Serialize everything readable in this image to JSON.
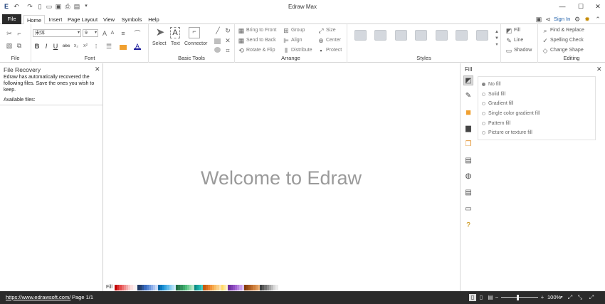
{
  "window": {
    "title": "Edraw Max",
    "minimize": "—",
    "maximize": "☐",
    "close": "✕"
  },
  "tabs": [
    "File",
    "Home",
    "Insert",
    "Page Layout",
    "View",
    "Symbols",
    "Help"
  ],
  "account": {
    "sign_in": "Sign In"
  },
  "ribbon": {
    "file_label": "File",
    "font": {
      "name": "宋体",
      "size": "9",
      "label": "Font",
      "bold": "B",
      "italic": "I",
      "underline": "U",
      "strike": "abc",
      "sub": "x₂",
      "sup": "x²",
      "color": "A"
    },
    "basic_tools": {
      "label": "Basic Tools",
      "select": "Select",
      "text": "Text",
      "connector": "Connector"
    },
    "arrange": {
      "label": "Arrange",
      "bring_front": "Bring to Front",
      "send_back": "Send to Back",
      "rotate_flip": "Rotate & Flip",
      "group": "Group",
      "align": "Align",
      "distribute": "Distribute",
      "size": "Size",
      "center": "Center",
      "protect": "Protect"
    },
    "styles": {
      "label": "Styles"
    },
    "format": {
      "fill": "Fill",
      "line": "Line",
      "shadow": "Shadow"
    },
    "editing": {
      "label": "Editing",
      "find_replace": "Find & Replace",
      "spelling": "Spelling Check",
      "change_shape": "Change Shape"
    }
  },
  "recovery": {
    "title": "File Recovery",
    "message": "Edraw has automatically recovered the following files. Save the ones you wish to keep.",
    "available": "Available files:"
  },
  "canvas": {
    "welcome": "Welcome to Edraw"
  },
  "fillbar": {
    "label": "Fill"
  },
  "fill_panel": {
    "title": "Fill",
    "options": [
      "No fill",
      "Solid fill",
      "Gradient fill",
      "Single color gradient fill",
      "Pattern fill",
      "Picture or texture fill"
    ],
    "selected": "No fill"
  },
  "status": {
    "url": "https://www.edrawsoft.com/",
    "page": "Page 1/1",
    "zoom": "100%"
  },
  "palette_colors": [
    "#c00000",
    "#d42a2a",
    "#e34b4b",
    "#ec6d6d",
    "#f08c8c",
    "#f4aaaa",
    "#f8c8c8",
    "#fbe0e0",
    "#fff0f0",
    "#f5f5f5",
    "#1f3864",
    "#24406f",
    "#2e5597",
    "#3a6bbf",
    "#4f81d0",
    "#6b97dc",
    "#8badea",
    "#abc3f0",
    "#c8daf8",
    "#0066a6",
    "#0a78bd",
    "#1b90d4",
    "#3aa5e0",
    "#5eb9ea",
    "#85ccf0",
    "#aadcf5",
    "#cceaf9",
    "#1f6e43",
    "#287d4e",
    "#32925c",
    "#3ea86b",
    "#4fbe7c",
    "#6fcc93",
    "#92d9ab",
    "#b6e6c6",
    "#0c8a85",
    "#14a39c",
    "#24b8b0",
    "#46c9c2",
    "#c55a11",
    "#d56b1d",
    "#e57e2a",
    "#f19338",
    "#f6a94d",
    "#f9be68",
    "#fbd089",
    "#fde2ae",
    "#ffd966",
    "#ffe699",
    "#fff2cc",
    "#7030a0",
    "#7e3db0",
    "#8f4dc2",
    "#a264d2",
    "#b580de",
    "#c89eea",
    "#dbbff3",
    "#833c0b",
    "#944813",
    "#a8581e",
    "#bc6b2c",
    "#cd7f3d",
    "#dc9555",
    "#e8ad74",
    "#404040",
    "#595959",
    "#737373",
    "#8c8c8c",
    "#a6a6a6",
    "#bfbfbf",
    "#d9d9d9",
    "#ececec"
  ]
}
